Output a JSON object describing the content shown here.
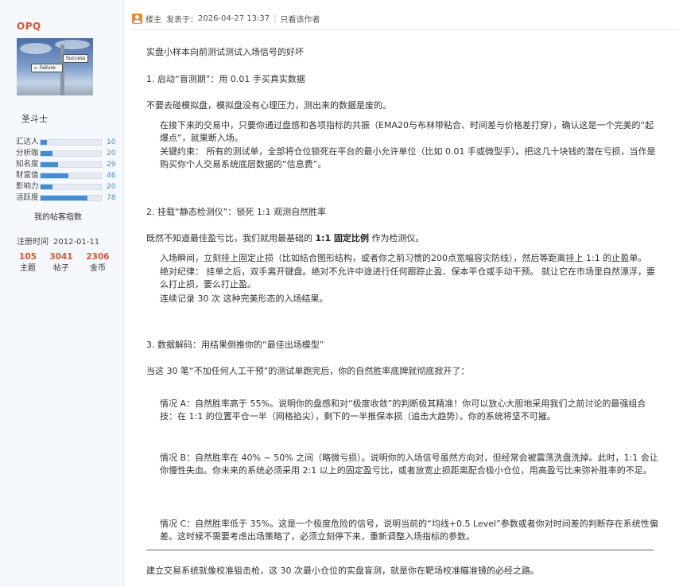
{
  "sidebar": {
    "username": "OPQ",
    "avatar_signs": {
      "success": "Success",
      "failure": "← Failure"
    },
    "rank": "圣斗士",
    "stats": [
      {
        "label": "汇达人",
        "value": "10",
        "pct": 10
      },
      {
        "label": "分析咖",
        "value": "20",
        "pct": 20
      },
      {
        "label": "知名度",
        "value": "29",
        "pct": 29
      },
      {
        "label": "财富值",
        "value": "46",
        "pct": 46
      },
      {
        "label": "影响力",
        "value": "20",
        "pct": 20
      },
      {
        "label": "活跃度",
        "value": "78",
        "pct": 78
      }
    ],
    "index_title": "我的帖客指数",
    "reg_label": "注册时间",
    "reg_date": "2012-01-11",
    "counts": [
      {
        "num": "105",
        "label": "主题"
      },
      {
        "num": "3041",
        "label": "帖子"
      },
      {
        "num": "2306",
        "label": "金币"
      }
    ]
  },
  "post": {
    "owner_label": "楼主",
    "posted_label": "发表于：",
    "posted_time": "2026-04-27 13:37",
    "only_author": "只看该作者",
    "paragraphs": {
      "p1": "实盘小样本向前测试测试入场信号的好坏",
      "p2": "1. 启动“盲测期”：用 0.01 手买真实数据",
      "p3": "不要去碰模拟盘，模拟盘没有心理压力，测出来的数据是废的。",
      "p4a": "在接下来的交易中，只要你通过盘感和各项指标的共振（EMA20与布林带粘合、时间差与价格差打穿），确认这是一个完美的“起爆点”，就果断入场。",
      "p4b": "关键约束： 所有的测试单，全部将仓位锁死在平台的最小允许单位（比如 0.01 手或微型手）。把这几十块钱的潜在亏损，当作是购买你个人交易系统底层数据的“信息费”。",
      "p5": "2. 挂载“静态检测仪”：锁死 1:1 观测自然胜率",
      "p6_pre": "既然不知道最佳盈亏比，我们就用最基础的 ",
      "p6_bold": "1:1 固定比例",
      "p6_post": " 作为检测仪。",
      "p7a": "入场瞬间，立刻挂上固定止损（比如结合图形结构，或者你之前习惯的200点宽幅容灾防线），然后等距离挂上 1:1 的止盈单。",
      "p7b": "绝对纪律： 挂单之后，双手离开键盘。绝对不允许中途进行任何跟踪止盈、保本平仓或手动干预。 就让它在市场里自然漂浮，要么打止损，要么打止盈。",
      "p7c": "连续记录 30 次 这种完美形态的入场结果。",
      "p8": "3. 数据解码：用结果倒推你的“最佳出场模型”",
      "p9": "当这 30 笔“不加任何人工干预”的测试单跑完后，你的自然胜率底牌就彻底掀开了：",
      "pA": "情况 A：自然胜率高于 55%。说明你的盘感和对“极度收敛”的判断极其精准！你可以放心大胆地采用我们之前讨论的最强组合技：在 1:1 的位置平仓一半（网格掐尖），剩下的一半推保本损（追击大趋势）。你的系统将坚不可摧。",
      "pB": "情况 B：自然胜率在 40% ~ 50% 之间（略微亏损）。说明你的入场信号虽然方向对，但经常会被震荡洗盘洗掉。此时，1:1 会让你慢性失血。你未来的系统必须采用 2:1 以上的固定盈亏比，或者放宽止损距离配合极小仓位，用高盈亏比来弥补胜率的不足。",
      "pC": "情况 C：自然胜率低于 35%。这是一个极度危险的信号，说明当前的“均线+0.5 Level”参数或者你对时间差的判断存在系统性偏差。这时候不需要考虑出场策略了，必须立刻停下来，重新调整入场指标的参数。",
      "p10": "建立交易系统就像校准狙击枪，这 30 次最小仓位的实盘盲测，就是你在靶场校准瞄准镜的必经之路。"
    }
  }
}
